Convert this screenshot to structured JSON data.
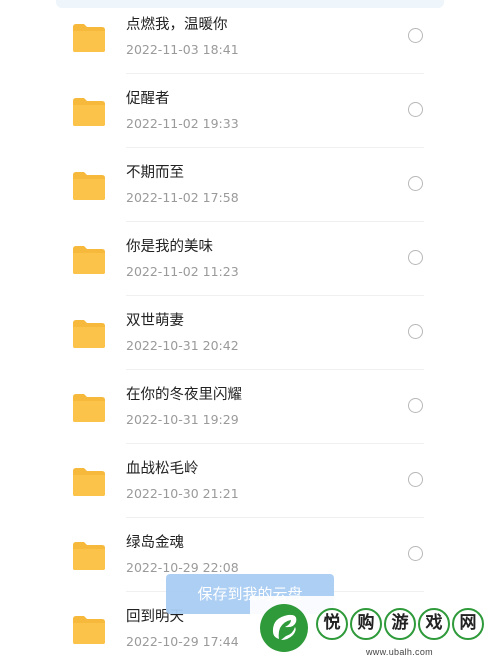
{
  "files": [
    {
      "name": "点燃我，温暖你",
      "date": "2022-11-03 18:41"
    },
    {
      "name": "促醒者",
      "date": "2022-11-02 19:33"
    },
    {
      "name": "不期而至",
      "date": "2022-11-02 17:58"
    },
    {
      "name": "你是我的美味",
      "date": "2022-11-02 11:23"
    },
    {
      "name": "双世萌妻",
      "date": "2022-10-31 20:42"
    },
    {
      "name": "在你的冬夜里闪耀",
      "date": "2022-10-31 19:29"
    },
    {
      "name": "血战松毛岭",
      "date": "2022-10-30 21:21"
    },
    {
      "name": "绿岛金魂",
      "date": "2022-10-29 22:08"
    },
    {
      "name": "回到明天",
      "date": "2022-10-29 17:44"
    }
  ],
  "actions": {
    "save_label": "保存到我的云盘"
  },
  "watermark": {
    "brand_chars": [
      "悦",
      "购",
      "游",
      "戏",
      "网"
    ],
    "url": "www.ubalh.com"
  },
  "icons": {
    "folder": "folder-icon",
    "select": "radio-unchecked-icon",
    "logo": "leaf-logo-icon"
  },
  "colors": {
    "folder": "#fcc34a",
    "button": "#a9cdf3",
    "watermark_green": "#2e9a3a"
  }
}
